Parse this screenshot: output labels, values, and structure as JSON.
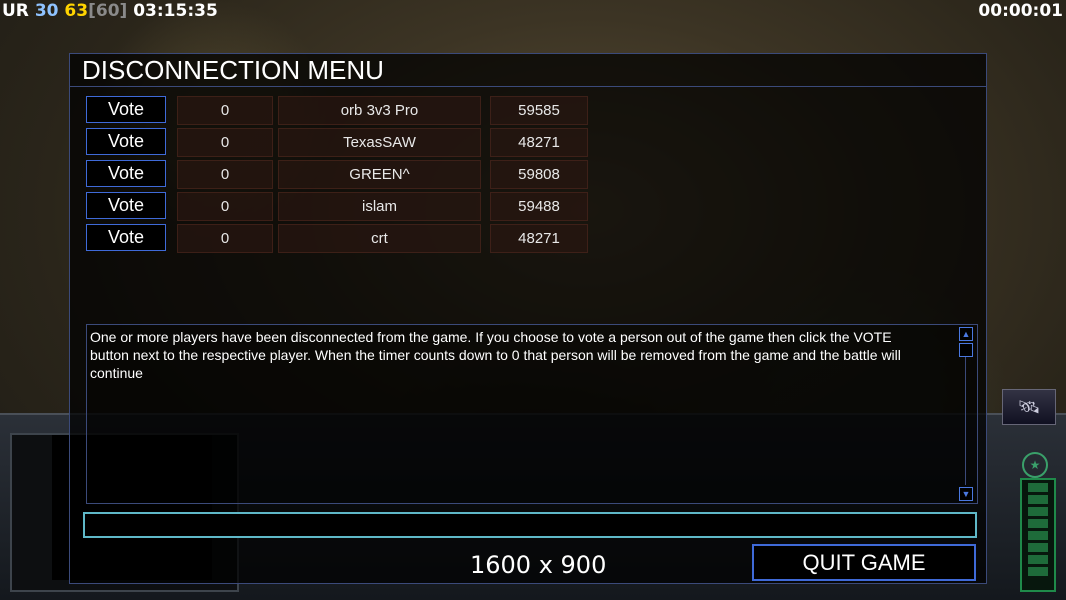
{
  "hud": {
    "stats": {
      "a": "UR",
      "b": "30",
      "c": "63",
      "d": "[60]",
      "time": "03:15:35"
    },
    "timer": "00:00:01",
    "colors": {
      "a": "#ffffff",
      "b": "#8fc3ff",
      "c": "#ffd400",
      "d": "#8a8a8a"
    }
  },
  "dialog": {
    "title": "DISCONNECTION MENU",
    "vote_label": "Vote",
    "players": [
      {
        "votes": "0",
        "name": "orb 3v3 Pro",
        "ping": "59585"
      },
      {
        "votes": "0",
        "name": "TexasSAW",
        "ping": "48271"
      },
      {
        "votes": "0",
        "name": "GREEN^",
        "ping": "59808"
      },
      {
        "votes": "0",
        "name": "islam",
        "ping": "59488"
      },
      {
        "votes": "0",
        "name": "crt",
        "ping": "48271"
      }
    ],
    "message_lines": [
      "One or more players have been disconnected from the game. If you choose to vote a person out of the game then click the VOTE",
      " button next to the respective player. When the timer counts down to 0 that person will be removed from the game and the battle will",
      " continue"
    ],
    "resolution": "1600 x 900",
    "quit_label": "QUIT GAME"
  }
}
